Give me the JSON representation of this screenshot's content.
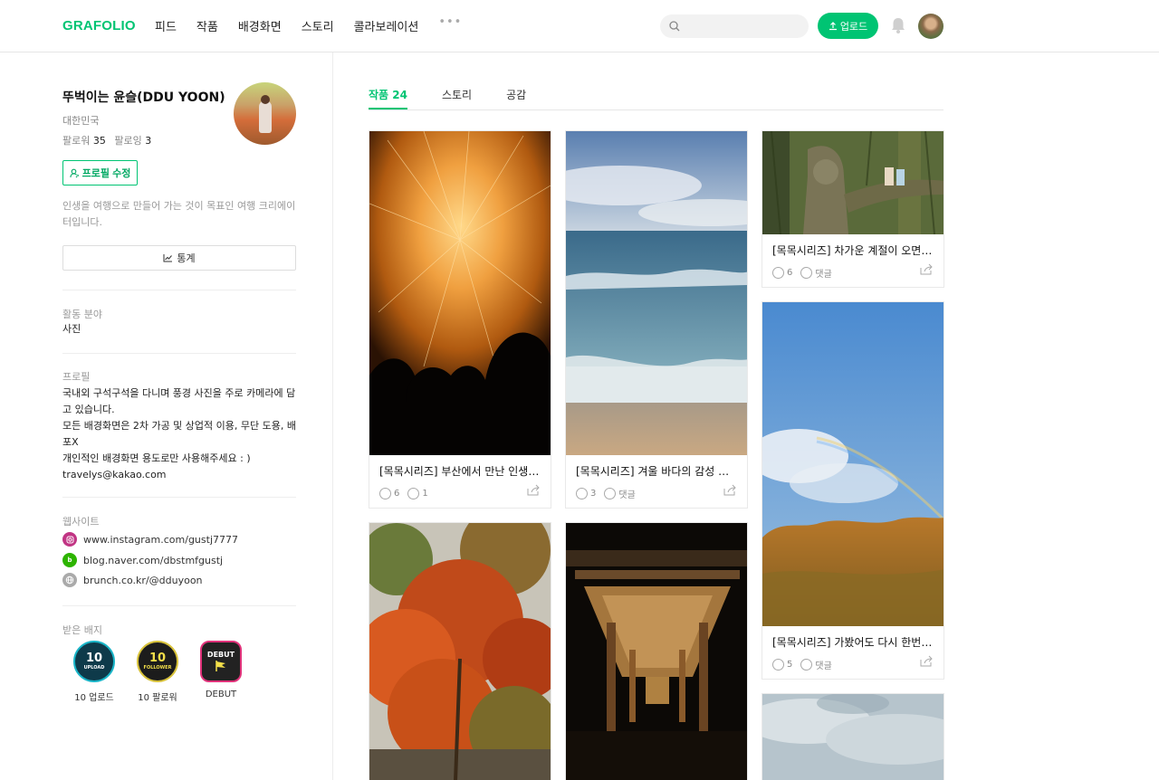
{
  "header": {
    "logo": "GRAFOLIO",
    "nav": [
      "피드",
      "작품",
      "배경화면",
      "스토리",
      "콜라보레이션"
    ],
    "more": "•••",
    "search_placeholder": "",
    "upload_label": "업로드"
  },
  "profile": {
    "name": "뚜벅이는 윤슬(DDU YOON)",
    "country": "대한민국",
    "followers_label": "팔로워",
    "followers": "35",
    "following_label": "팔로잉",
    "following": "3",
    "edit_label": "프로필 수정",
    "bio": "인생을 여행으로 만들어 가는 것이 목표인 여행 크리에이터입니다.",
    "stats_label": "통계"
  },
  "sections": {
    "field_title": "활동 분야",
    "field_value": "사진",
    "profile_title": "프로필",
    "profile_lines": [
      "국내외 구석구석을 다니며 풍경 사진을 주로 카메라에 담고 있습니다.",
      "모든 배경화면은 2차 가공 및 상업적 이용, 무단 도용, 배포X",
      "개인적인 배경화면 용도로만 사용해주세요 : )",
      "travelys@kakao.com"
    ],
    "website_title": "웹사이트",
    "websites": [
      {
        "icon": "instagram-icon",
        "url": "www.instagram.com/gustj7777",
        "color": "#c13584"
      },
      {
        "icon": "blog-icon",
        "url": "blog.naver.com/dbstmfgustj",
        "color": "#2db400"
      },
      {
        "icon": "globe-icon",
        "url": "brunch.co.kr/@dduyoon",
        "color": "#aaaaaa"
      }
    ],
    "badge_title": "받은 배지",
    "badges": [
      {
        "num": "10",
        "sub": "UPLOAD",
        "label": "10 업로드",
        "bg": "#0e3a4a",
        "ring": "#19b5c8",
        "fg": "#ffffff"
      },
      {
        "num": "10",
        "sub": "FOLLOWER",
        "label": "10 팔로워",
        "bg": "#1c1c1c",
        "ring": "#d8c23a",
        "fg": "#f3df4a"
      },
      {
        "num": "DEBUT",
        "sub": "",
        "label": "DEBUT",
        "bg": "#222222",
        "ring": "#e0327a",
        "fg": "#ffffff"
      }
    ]
  },
  "tabs": [
    {
      "label": "작품 24",
      "active": true
    },
    {
      "label": "스토리",
      "active": false
    },
    {
      "label": "공감",
      "active": false
    }
  ],
  "cards": [
    {
      "title": "[목목시리즈] 부산에서 만난 인생 ...",
      "likes": "6",
      "comments": "1"
    },
    {
      "title": "[목목시리즈] 겨울 바다의 감성 그...",
      "likes": "3",
      "comments": "댓글"
    },
    {
      "title": "[목목시리즈] 차가운 계절이 오면 ...",
      "likes": "6",
      "comments": "댓글"
    },
    {
      "title": "[목목시리즈] 가봤어도 다시 한번,...",
      "likes": "5",
      "comments": "댓글"
    }
  ]
}
